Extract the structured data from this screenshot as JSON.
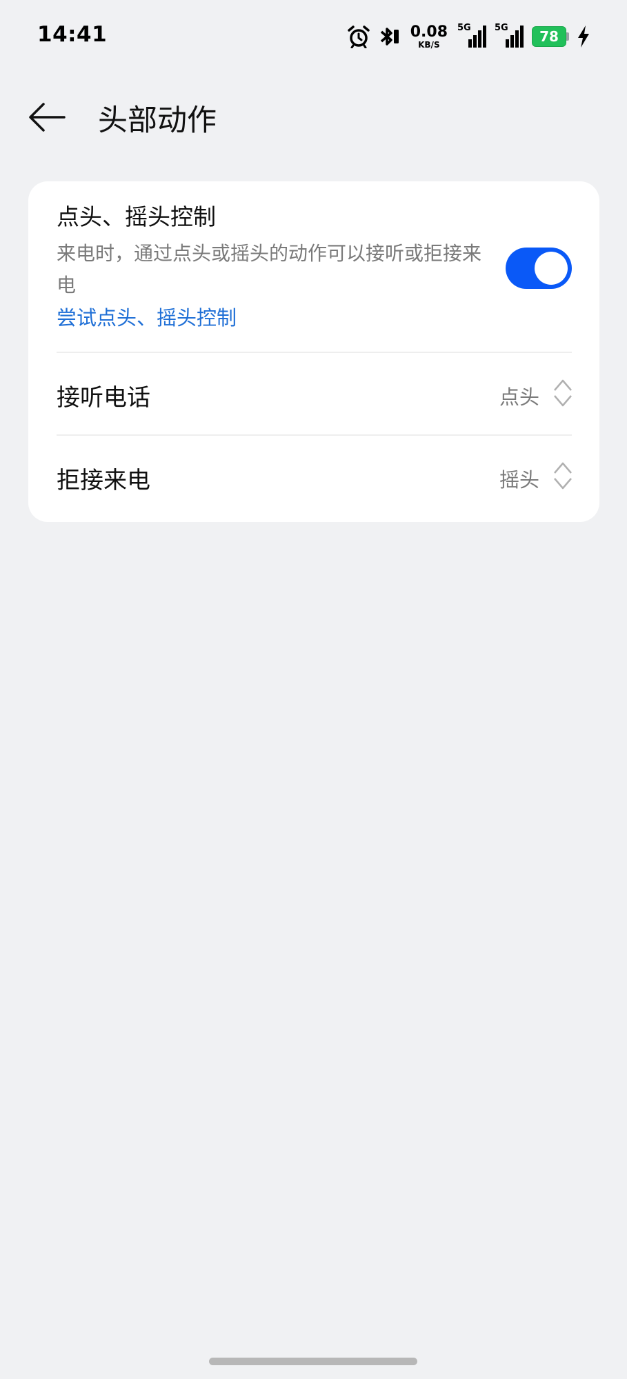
{
  "status_bar": {
    "time": "14:41",
    "net_speed_value": "0.08",
    "net_speed_unit": "KB/S",
    "sim1_label": "5G",
    "sim2_label": "5G",
    "battery_level": "78",
    "battery_color": "#21c05a",
    "icons": [
      "alarm-icon",
      "bluetooth-icon",
      "signal-icon",
      "signal-icon",
      "battery-icon",
      "charging-bolt-icon"
    ]
  },
  "header": {
    "title": "头部动作",
    "back_icon": "arrow-left-icon"
  },
  "card": {
    "head_control": {
      "title": "点头、摇头控制",
      "description": "来电时，通过点头或摇头的动作可以接听或拒接来电",
      "link": "尝试点头、摇头控制",
      "enabled": true,
      "accent_color": "#0a59f7"
    },
    "rows": [
      {
        "label": "接听电话",
        "value": "点头"
      },
      {
        "label": "拒接来电",
        "value": "摇头"
      }
    ]
  }
}
